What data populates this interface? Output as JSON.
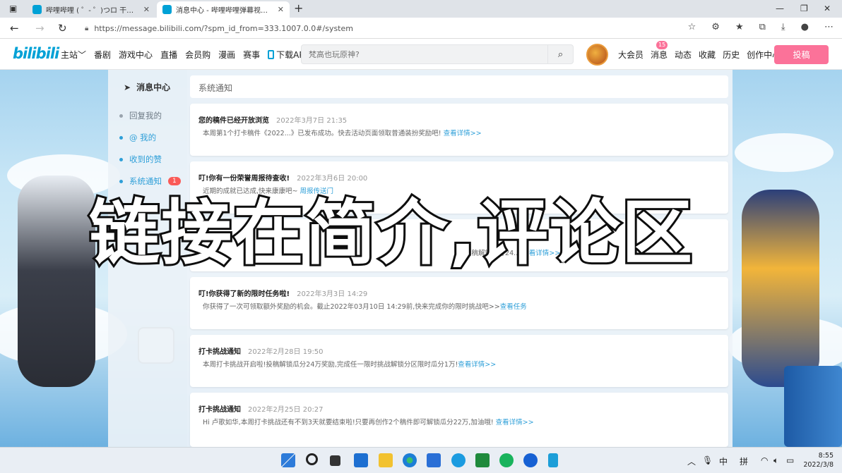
{
  "browser": {
    "tabs": [
      {
        "title": "哔哩哔哩 ( ゜- ゜)つロ 干杯~-bilibili",
        "active": false
      },
      {
        "title": "消息中心 - 哔哩哔哩弹幕视频网",
        "active": true
      }
    ],
    "new_tab": "+",
    "url": "https://message.bilibili.com/?spm_id_from=333.1007.0.0#/system"
  },
  "header": {
    "logo": "bilibili",
    "nav": [
      "主站",
      "番剧",
      "游戏中心",
      "直播",
      "会员购",
      "漫画",
      "赛事"
    ],
    "download_app": "下载APP",
    "search_placeholder": "梵高也玩原神?",
    "user_nav": [
      "大会员",
      "消息",
      "动态",
      "收藏",
      "历史",
      "创作中心"
    ],
    "message_badge": "15",
    "upload_label": "投稿"
  },
  "sidebar": {
    "title": "消息中心",
    "items": [
      {
        "label": "回复我的"
      },
      {
        "label": "@ 我的"
      },
      {
        "label": "收到的赞"
      },
      {
        "label": "系统通知",
        "badge": "1"
      }
    ]
  },
  "main": {
    "section_title": "系统通知",
    "cards": [
      {
        "title": "您的稿件已经开放浏览",
        "date": "2022年3月7日 21:35",
        "body": "本周第1个打卡稿件《2022...》已发布成功。快去活动页面领取普通装扮奖励吧!",
        "link": "查看详情>>"
      },
      {
        "title": "叮!你有一份荣誉周报待查收!",
        "date": "2022年3月6日 20:00",
        "body": "近期的成就已达成,快来康康吧~",
        "link": "周报传送门"
      },
      {
        "title": "",
        "date": "",
        "body": "...投稿解锁瓜分24...",
        "link": "查看详情>>"
      },
      {
        "title": "叮!你获得了新的限时任务啦!",
        "date": "2022年3月3日 14:29",
        "body": "你获得了一次可领取额外奖励的机会。截止2022年03月10日 14:29前,快来完成你的限时挑战吧>>",
        "link": "查看任务"
      },
      {
        "title": "打卡挑战通知",
        "date": "2022年2月28日 19:50",
        "body": "本周打卡挑战开启啦!投稿解锁瓜分24万奖励,完成任一限时挑战解锁分区限时瓜分1万!",
        "link": "查看详情>>"
      },
      {
        "title": "打卡挑战通知",
        "date": "2022年2月25日 20:27",
        "body": "Hi 卢歌如华,本周打卡挑战还有不到3天就要结束啦!只要再创作2个稿件即可解锁瓜分22万,加油哦!",
        "link": "查看详情>>"
      }
    ]
  },
  "overlay_text": "链接在简介,评论区",
  "taskbar": {
    "ime": [
      "中",
      "拼"
    ],
    "time": "8:55",
    "date": "2022/3/8"
  },
  "colors": {
    "brand": "#00a1d6",
    "pink": "#fb7299",
    "link": "#2e9fd8"
  }
}
